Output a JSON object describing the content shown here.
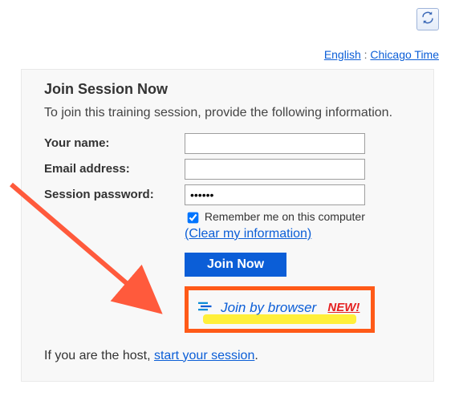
{
  "topbar": {
    "language_link": "English",
    "separator": ":",
    "timezone_link": "Chicago Time"
  },
  "panel": {
    "title": "Join Session Now",
    "intro": "To join this training session, provide the following information.",
    "fields": {
      "name_label": "Your name:",
      "email_label": "Email address:",
      "password_label": "Session password:",
      "password_value": "••••••",
      "remember_label": "Remember me on this computer",
      "clear_link": "(Clear my information)"
    },
    "actions": {
      "join_button": "Join Now",
      "join_browser_label": "Join by browser",
      "new_badge": "NEW!"
    },
    "host": {
      "prefix": "If you are the host, ",
      "link": "start your session",
      "suffix": "."
    }
  }
}
